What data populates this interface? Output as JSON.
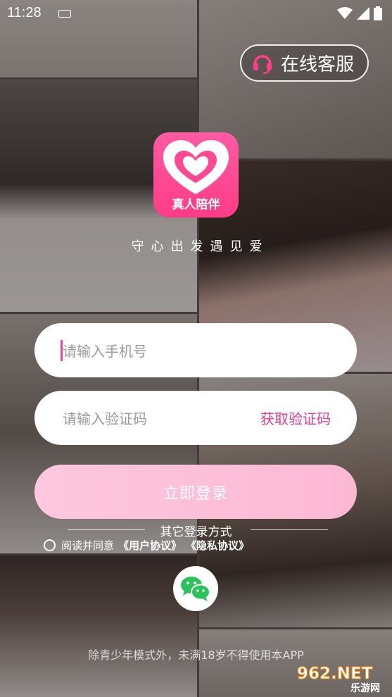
{
  "status_bar": {
    "time": "11:28"
  },
  "header": {
    "customer_service_label": "在线客服"
  },
  "logo": {
    "text": "真人陪伴"
  },
  "slogan": "守心出发遇见爱",
  "form": {
    "phone_placeholder": "请输入手机号",
    "code_placeholder": "请输入验证码",
    "get_code_label": "获取验证码",
    "login_label": "立即登录"
  },
  "other_login": {
    "label": "其它登录方式"
  },
  "agreement": {
    "prefix": "阅读并同意",
    "user_agreement": "《用户协议》",
    "privacy_agreement": "《隐私协议》"
  },
  "notice": "除青少年模式外，未满18岁不得使用本APP",
  "watermark": {
    "main": "962.NET",
    "sub": "乐游网"
  },
  "colors": {
    "accent": "#e33c8d",
    "logo": "#ff4a93",
    "login_button": "#fbc3da"
  }
}
